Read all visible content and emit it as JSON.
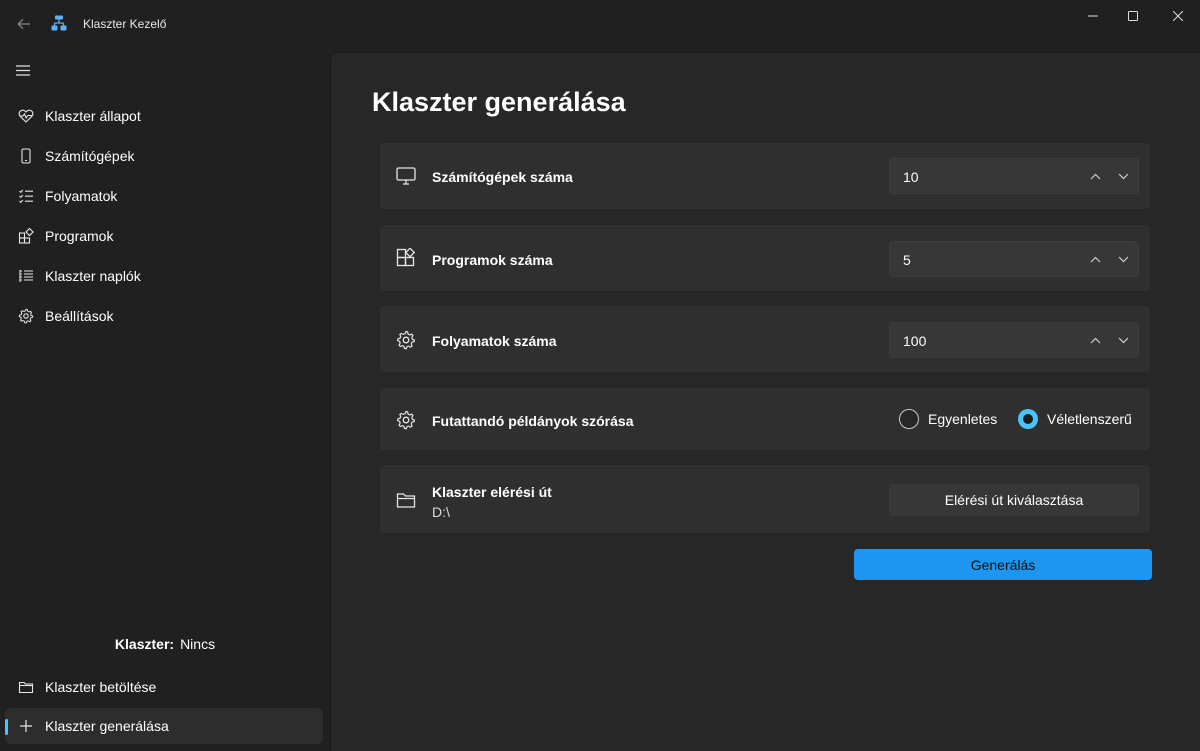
{
  "window": {
    "title": "Klaszter Kezelő"
  },
  "sidebar": {
    "items": [
      {
        "label": "Klaszter állapot",
        "icon": "heart-pulse-icon"
      },
      {
        "label": "Számítógépek",
        "icon": "phone-icon"
      },
      {
        "label": "Folyamatok",
        "icon": "checklist-icon"
      },
      {
        "label": "Programok",
        "icon": "apps-icon"
      },
      {
        "label": "Klaszter naplók",
        "icon": "list-icon"
      },
      {
        "label": "Beállítások",
        "icon": "gear-icon"
      }
    ],
    "status": {
      "label": "Klaszter:",
      "value": "Nincs"
    },
    "footer_items": [
      {
        "label": "Klaszter betöltése",
        "icon": "folder-icon"
      },
      {
        "label": "Klaszter generálása",
        "icon": "plus-icon",
        "selected": true
      }
    ]
  },
  "main": {
    "title": "Klaszter generálása",
    "computers": {
      "label": "Számítógépek száma",
      "value": "10"
    },
    "programs": {
      "label": "Programok száma",
      "value": "5"
    },
    "processes": {
      "label": "Folyamatok száma",
      "value": "100"
    },
    "distribution": {
      "label": "Futattandó példányok szórása",
      "options": [
        "Egyenletes",
        "Véletlenszerű"
      ],
      "selected": "Véletlenszerű"
    },
    "path": {
      "label": "Klaszter elérési út",
      "value": "D:\\",
      "button": "Elérési út kiválasztása"
    },
    "generate_button": "Generálás"
  },
  "colors": {
    "accent": "#4cc2ff",
    "primary_button": "#1c96f0",
    "background": "#202020",
    "card": "#2f2f2f"
  }
}
